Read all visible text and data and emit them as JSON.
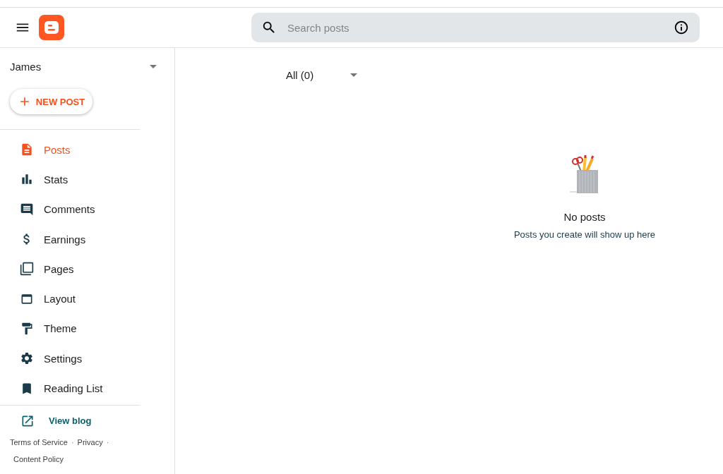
{
  "header": {
    "search": {
      "placeholder": "Search posts"
    }
  },
  "sidebar": {
    "blog_name": "James",
    "new_post_button": "NEW POST",
    "items": [
      {
        "label": "Posts",
        "selected": true
      },
      {
        "label": "Stats",
        "selected": false
      },
      {
        "label": "Comments",
        "selected": false
      },
      {
        "label": "Earnings",
        "selected": false
      },
      {
        "label": "Pages",
        "selected": false
      },
      {
        "label": "Layout",
        "selected": false
      },
      {
        "label": "Theme",
        "selected": false
      },
      {
        "label": "Settings",
        "selected": false
      },
      {
        "label": "Reading List",
        "selected": false
      }
    ],
    "view_blog": "View blog",
    "footer_links": [
      "Terms of Service",
      "Privacy",
      "Content Policy"
    ],
    "footer_separators": [
      "·",
      "·"
    ]
  },
  "content": {
    "filter": "All (0)",
    "empty_title": "No posts",
    "empty_message": "Posts you create will show up here"
  }
}
